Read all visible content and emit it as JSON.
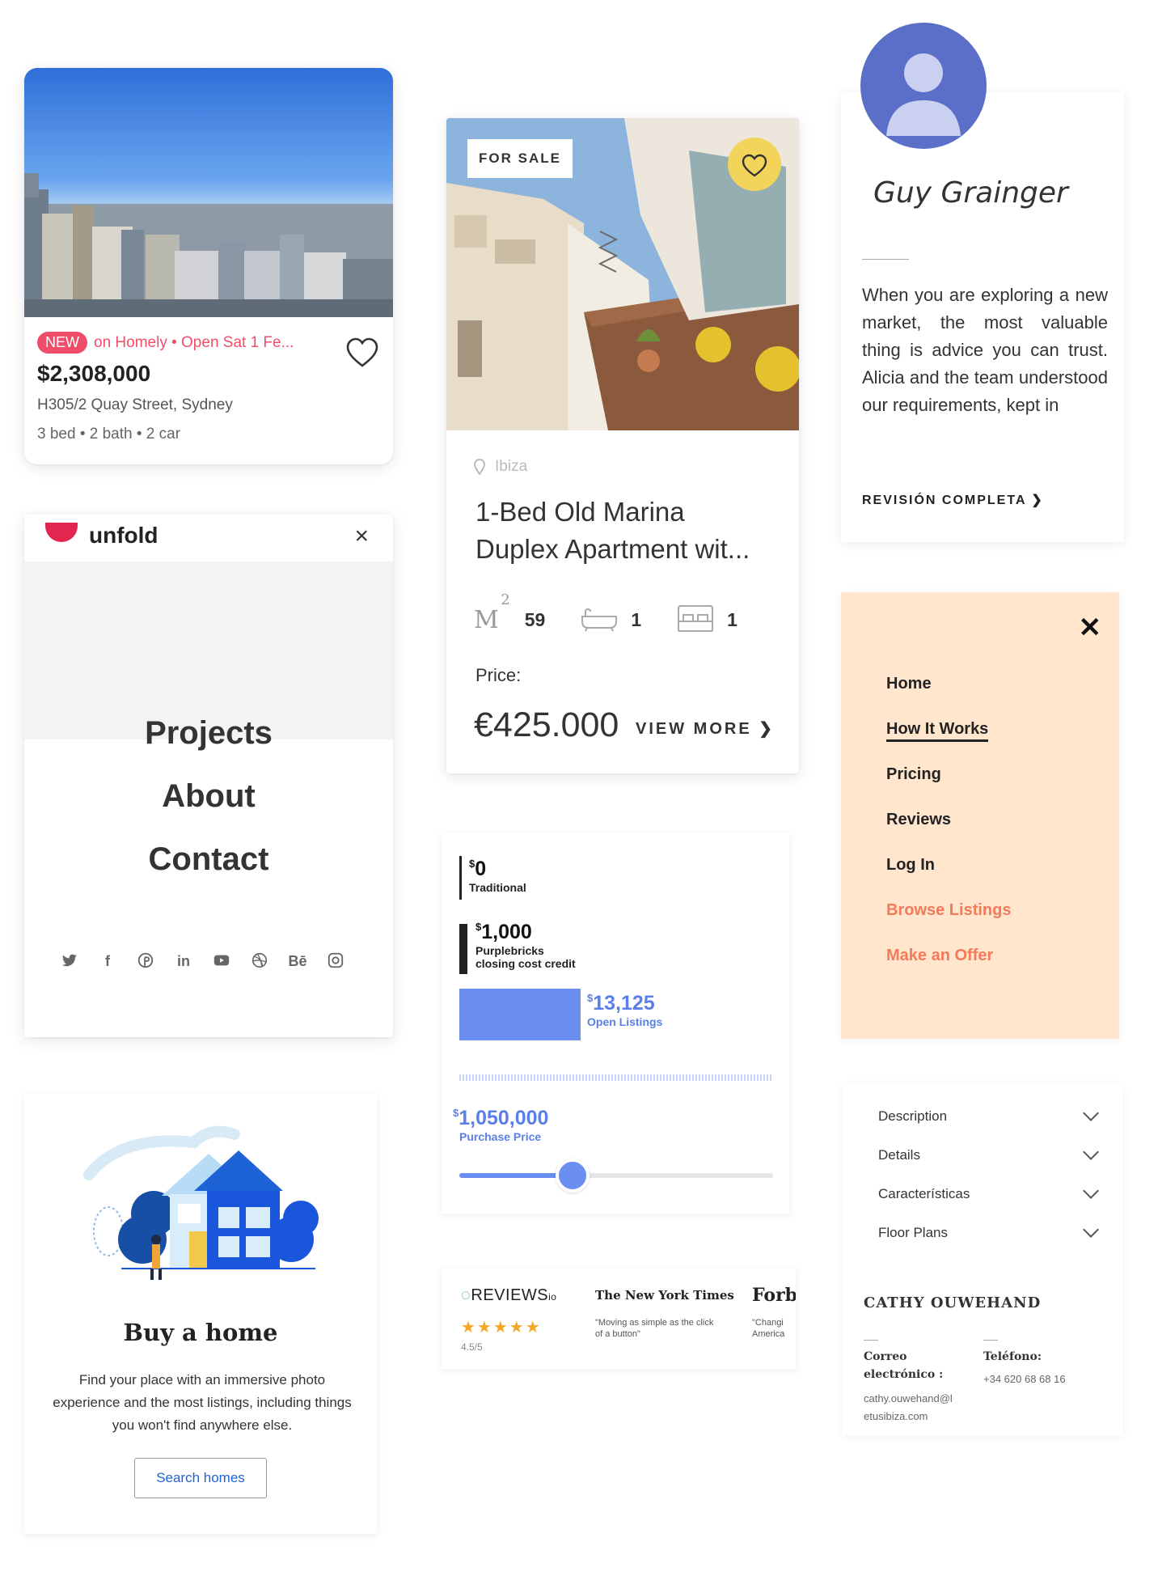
{
  "homely_card": {
    "new_badge": "NEW",
    "tagline": "on Homely • Open Sat 1 Fe...",
    "price": "$2,308,000",
    "address": "H305/2 Quay Street, Sydney",
    "specs": "3 bed • 2 bath • 2 car"
  },
  "unfold_menu": {
    "logo": "unfold",
    "close": "×",
    "items": [
      "Projects",
      "About",
      "Contact"
    ],
    "socials": [
      "twitter-icon",
      "facebook-icon",
      "pinterest-icon",
      "linkedin-icon",
      "youtube-icon",
      "dribbble-icon",
      "behance-icon",
      "instagram-icon"
    ]
  },
  "buy_home": {
    "title": "Buy a home",
    "description": "Find your place with an immersive photo experience and the most listings, including things you won't find anywhere else.",
    "button": "Search homes"
  },
  "ibiza_listing": {
    "badge": "FOR SALE",
    "location": "Ibiza",
    "title_line1": "1-Bed Old Marina",
    "title_line2": "Duplex Apartment wit...",
    "area_unit": "M",
    "area_sup": "2",
    "area": "59",
    "baths": "1",
    "beds": "1",
    "price_label": "Price:",
    "price": "€425.000",
    "view_more": "VIEW MORE ❯"
  },
  "savings": {
    "traditional_value": "0",
    "traditional_label": "Traditional",
    "credit_value": "1,000",
    "credit_label_1": "Purplebricks",
    "credit_label_2": "closing cost credit",
    "open_value": "13,125",
    "open_label": "Open Listings",
    "purchase_value": "1,050,000",
    "purchase_label": "Purchase Price",
    "currency": "$",
    "slider_fraction": 0.36,
    "accent": "#6b8ff0"
  },
  "reviews": {
    "brand": "REVIEWS",
    "brand_suffix": "io",
    "stars": "★★★★★",
    "score": "4.5/5",
    "nyt": "The New York Times",
    "nyt_quote": "\"Moving as simple as the click of a button\"",
    "forbes": "Forb",
    "forbes_quote_1": "\"Changi",
    "forbes_quote_2": "America"
  },
  "testimonial": {
    "name": "Guy Grainger",
    "quote": "When you are exploring a new market, the most valuable thing is advice you can trust. Alicia and the team understood our requirements, kept in",
    "link": "REVISIÓN COMPLETA ❯"
  },
  "peach_menu": {
    "close": "✕",
    "items": [
      "Home",
      "How It Works",
      "Pricing",
      "Reviews",
      "Log In"
    ],
    "cta_items": [
      "Browse Listings",
      "Make an Offer"
    ],
    "accent": "#f47a5a",
    "background": "#ffe6cd"
  },
  "agent_card": {
    "sections": [
      "Description",
      "Details",
      "Características",
      "Floor Plans"
    ],
    "agent_name": "CATHY OUWEHAND",
    "email_label_1": "Correo",
    "email_label_2": "electrónico :",
    "email_1": "cathy.ouwehand@l",
    "email_2": "etusibiza.com",
    "phone_label": "Teléfono:",
    "phone": "+34 620 68 68 16"
  }
}
